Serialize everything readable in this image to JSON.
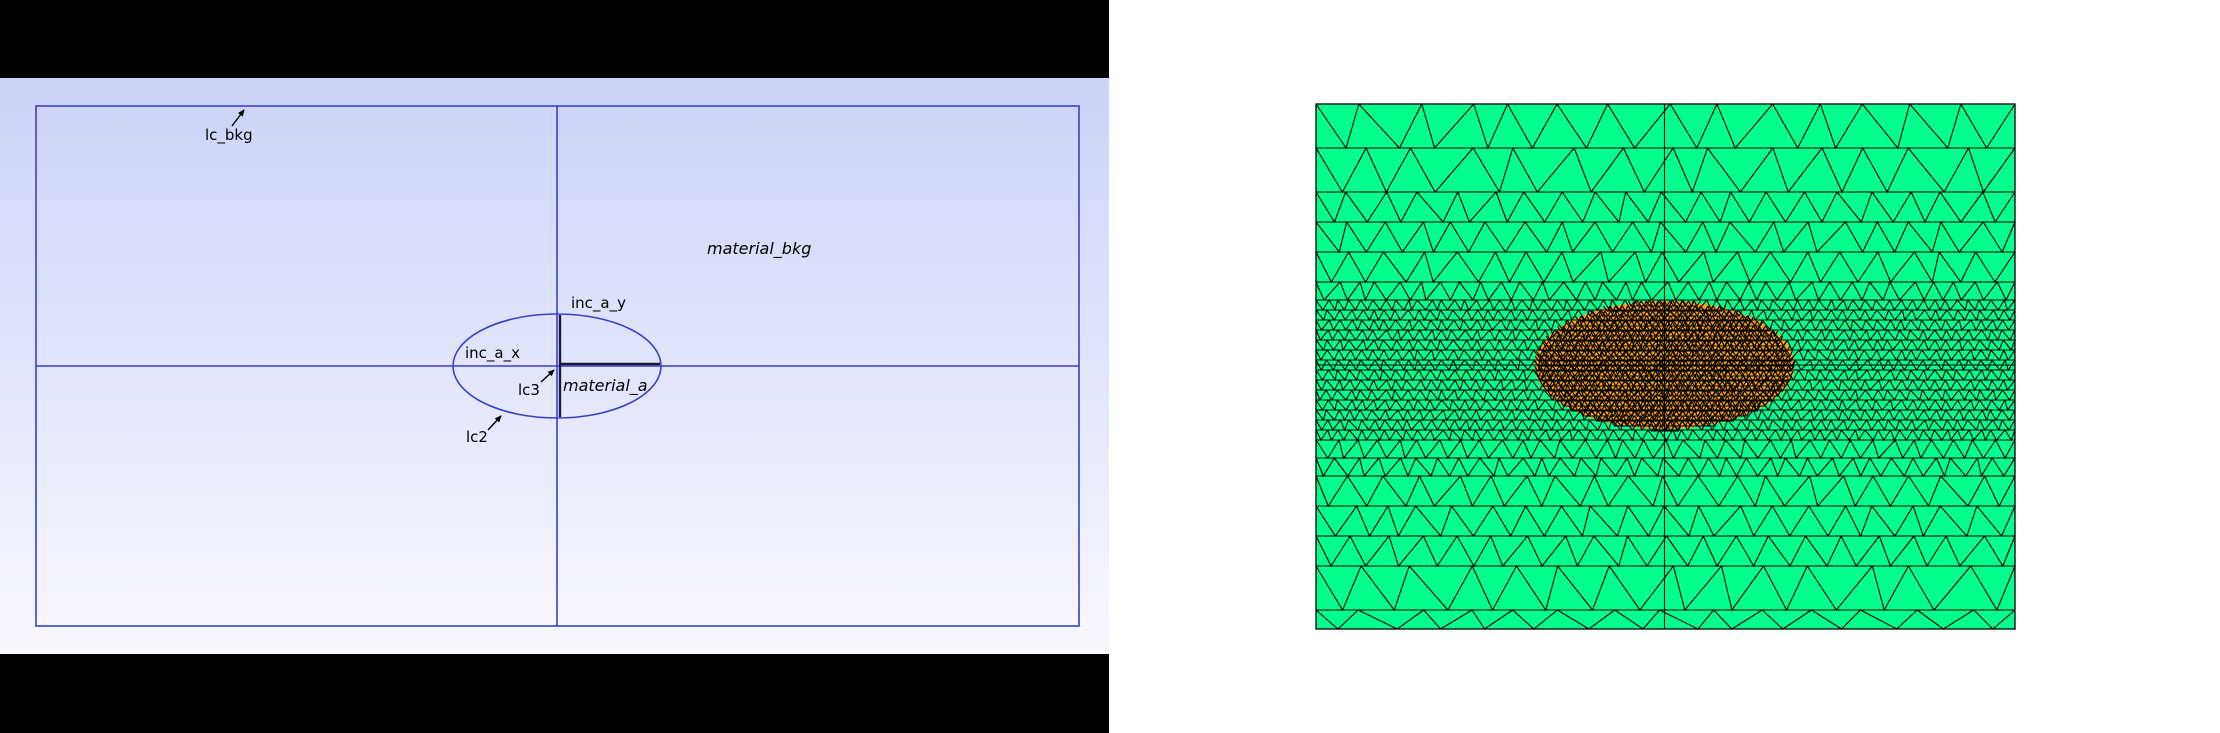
{
  "labels": {
    "lc_bkg": "lc_bkg",
    "lc2": "lc2",
    "lc3": "lc3",
    "inc_a_x": "inc_a_x",
    "inc_a_y": "inc_a_y",
    "material_a": "material_a",
    "material_bkg": "material_bkg"
  },
  "colors": {
    "letterbox": "#000000",
    "gradient_top": "#ccd3f8",
    "gradient_bottom": "#f8f8fe",
    "geometry_line": "#3a3fd0",
    "mesh_background": "#00ff8c",
    "mesh_inclusion": "#ffa313",
    "mesh_edge": "#000000"
  }
}
